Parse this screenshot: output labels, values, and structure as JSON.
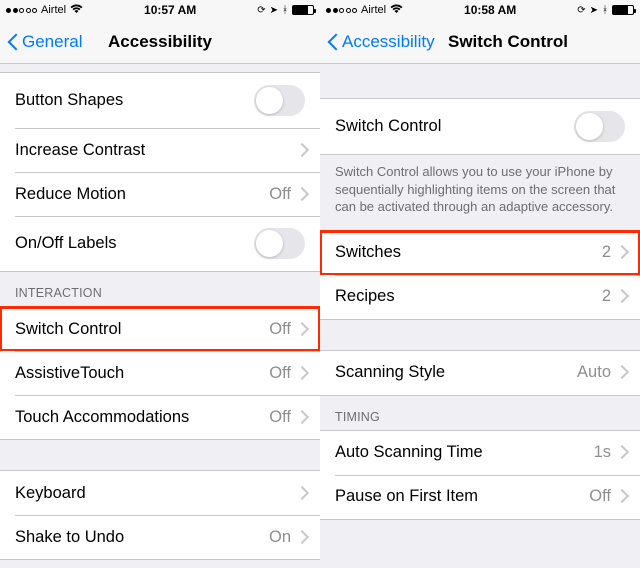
{
  "left": {
    "statusbar": {
      "carrier": "Airtel",
      "time": "10:57 AM"
    },
    "nav": {
      "back": "General",
      "title": "Accessibility"
    },
    "rows": {
      "button_shapes": "Button Shapes",
      "increase_contrast": "Increase Contrast",
      "reduce_motion": {
        "label": "Reduce Motion",
        "value": "Off"
      },
      "onoff_labels": "On/Off Labels",
      "interaction_header": "INTERACTION",
      "switch_control": {
        "label": "Switch Control",
        "value": "Off"
      },
      "assistive_touch": {
        "label": "AssistiveTouch",
        "value": "Off"
      },
      "touch_accommodations": {
        "label": "Touch Accommodations",
        "value": "Off"
      },
      "keyboard": "Keyboard",
      "shake_to_undo": {
        "label": "Shake to Undo",
        "value": "On"
      }
    }
  },
  "right": {
    "statusbar": {
      "carrier": "Airtel",
      "time": "10:58 AM"
    },
    "nav": {
      "back": "Accessibility",
      "title": "Switch Control"
    },
    "rows": {
      "switch_control": "Switch Control",
      "footer": "Switch Control allows you to use your iPhone by sequentially highlighting items on the screen that can be activated through an adaptive accessory.",
      "switches": {
        "label": "Switches",
        "value": "2"
      },
      "recipes": {
        "label": "Recipes",
        "value": "2"
      },
      "scanning_style": {
        "label": "Scanning Style",
        "value": "Auto"
      },
      "timing_header": "TIMING",
      "auto_scanning_time": {
        "label": "Auto Scanning Time",
        "value": "1s"
      },
      "pause_first_item": {
        "label": "Pause on First Item",
        "value": "Off"
      }
    }
  }
}
